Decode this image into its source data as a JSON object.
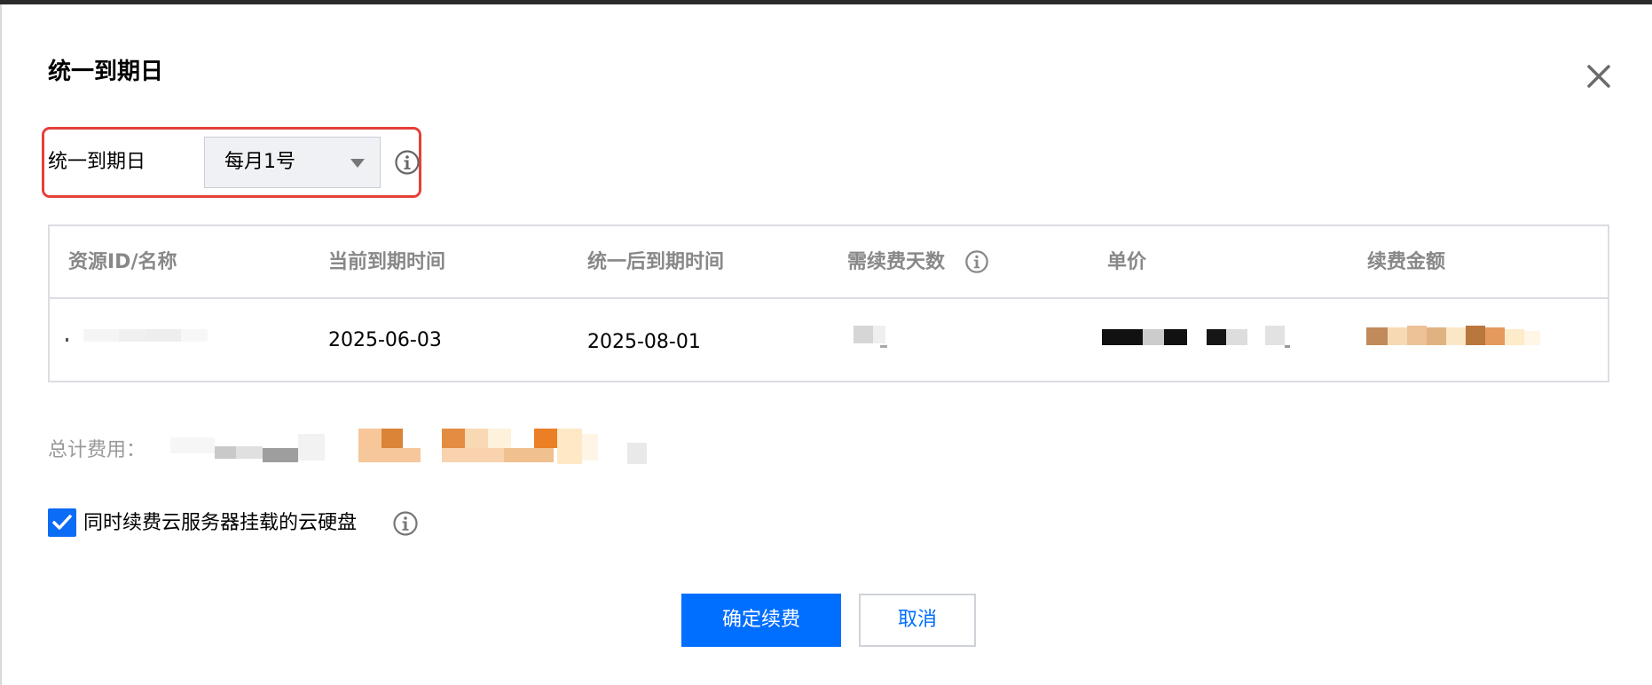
{
  "dialog": {
    "title": "统一到期日",
    "close_icon": "close-icon"
  },
  "expiry_field": {
    "label": "统一到期日",
    "selected_value": "每月1号",
    "info_icon": "info-icon"
  },
  "table": {
    "columns": [
      "资源ID/名称",
      "当前到期时间",
      "统一后到期时间",
      "需续费天数",
      "单价",
      "续费金额"
    ],
    "rows": [
      {
        "current_expiry": "2025-06-03",
        "unified_expiry": "2025-08-01"
      }
    ]
  },
  "total": {
    "label": "总计费用："
  },
  "checkbox": {
    "label": "同时续费云服务器挂载的云硬盘",
    "checked": true
  },
  "buttons": {
    "confirm": "确定续费",
    "cancel": "取消"
  },
  "colors": {
    "primary": "#006eff",
    "highlight_border": "#e5403a",
    "header_text": "#888888"
  }
}
